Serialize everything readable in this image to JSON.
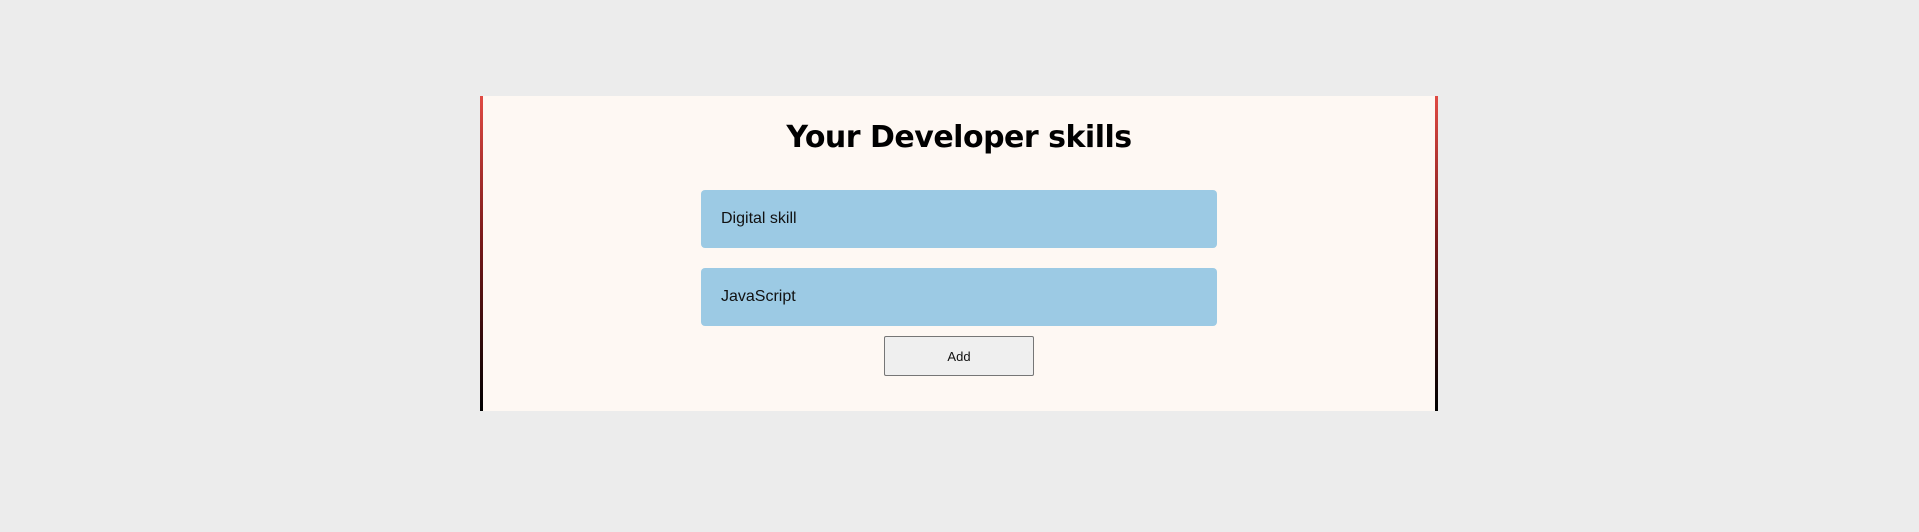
{
  "page": {
    "title": "Your Developer skills"
  },
  "skills": {
    "items": [
      {
        "value": "Digital skill"
      },
      {
        "value": "JavaScript"
      }
    ]
  },
  "actions": {
    "add_label": "Add"
  },
  "colors": {
    "background": "#ececec",
    "card": "#fef8f3",
    "input_fill": "#9ccae4",
    "border_gradient_top": "#e04a43",
    "border_gradient_bottom": "#000000"
  }
}
